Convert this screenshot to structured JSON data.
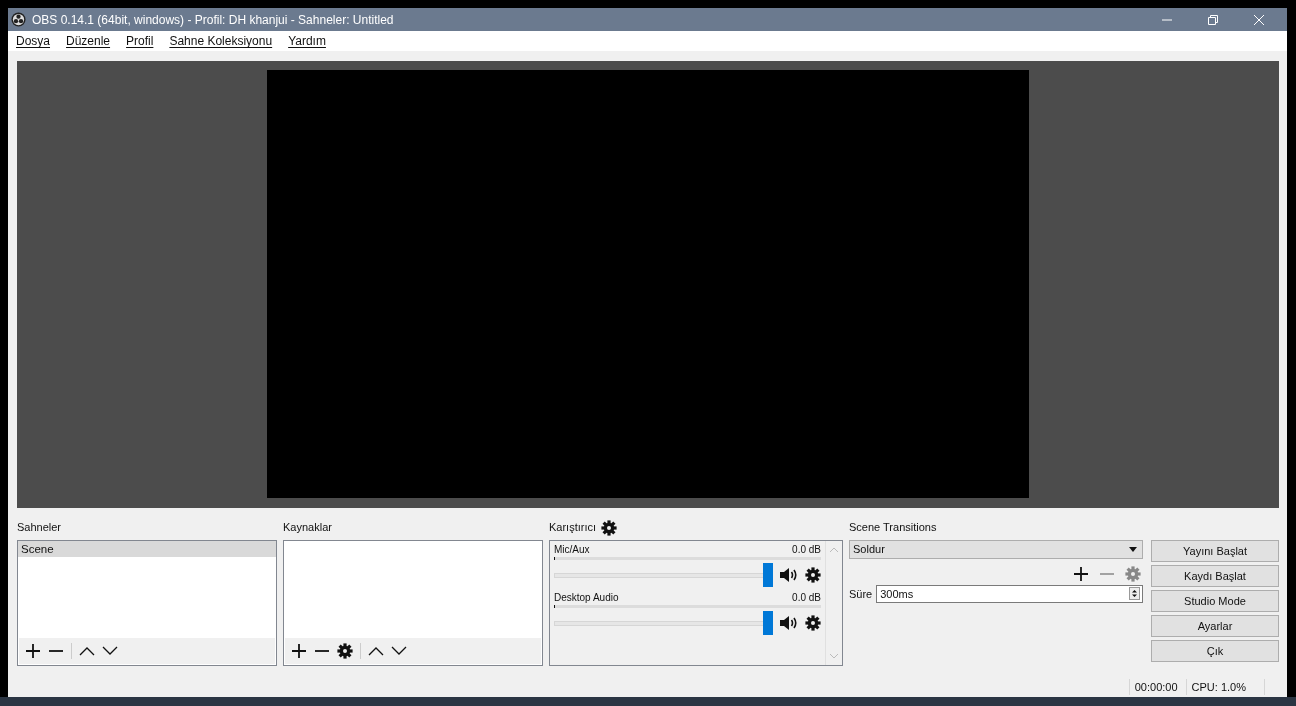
{
  "window": {
    "title": "OBS 0.14.1 (64bit, windows) - Profil: DH khanjui - Sahneler: Untitled"
  },
  "menu": [
    "Dosya",
    "Düzenle",
    "Profil",
    "Sahne Koleksiyonu",
    "Yardım"
  ],
  "scenes": {
    "title": "Sahneler",
    "items": [
      {
        "label": "Scene",
        "selected": true
      }
    ]
  },
  "sources": {
    "title": "Kaynaklar"
  },
  "mixer": {
    "title": "Karıştırıcı",
    "channels": [
      {
        "name": "Mic/Aux",
        "reading": "0.0 dB",
        "level": 1
      },
      {
        "name": "Desktop Audio",
        "reading": "0.0 dB",
        "level": 1
      }
    ]
  },
  "transitions": {
    "title": "Scene Transitions",
    "selected": "Soldur",
    "duration_label": "Süre",
    "duration": "300ms"
  },
  "buttons": [
    "Yayını Başlat",
    "Kaydı Başlat",
    "Studio Mode",
    "Ayarlar",
    "Çık"
  ],
  "status_bar": [
    "00:00:00",
    "CPU: 1.0%"
  ]
}
